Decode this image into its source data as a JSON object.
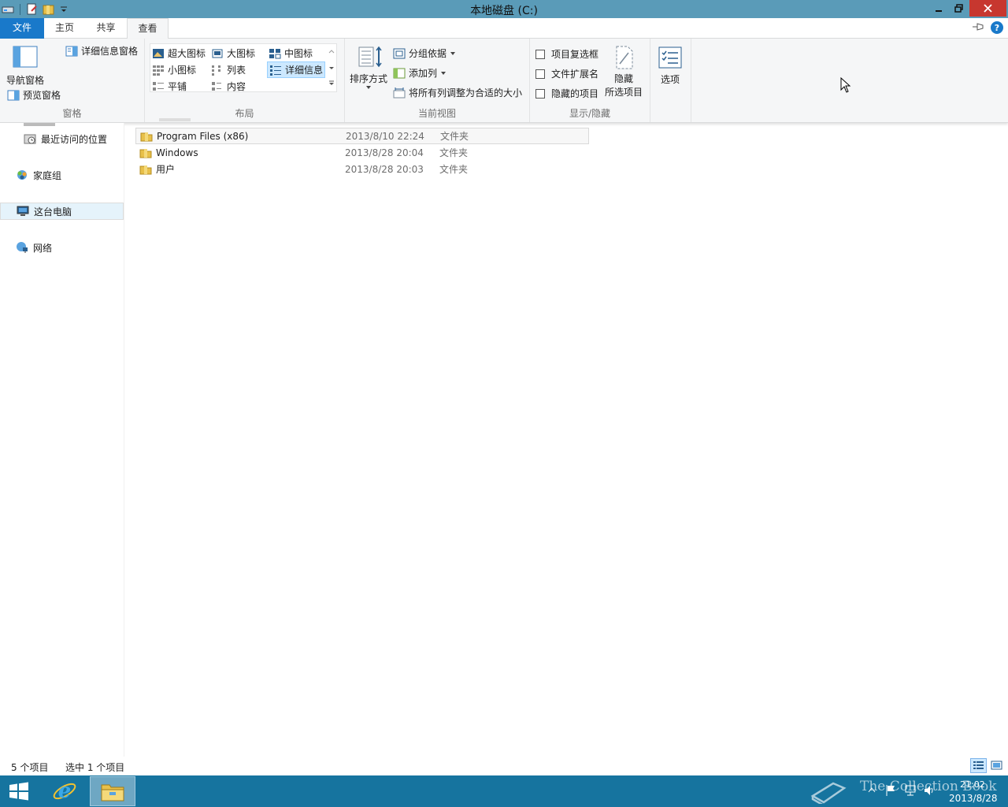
{
  "window": {
    "title": "本地磁盘 (C:)"
  },
  "ribbon": {
    "tabs": {
      "file": "文件",
      "home": "主页",
      "share": "共享",
      "view": "查看"
    },
    "panes": {
      "nav_pane": "导航窗格",
      "preview_pane": "预览窗格",
      "details_pane": "详细信息窗格",
      "label": "窗格"
    },
    "layout": {
      "extra_large": "超大图标",
      "large": "大图标",
      "medium": "中图标",
      "small": "小图标",
      "list": "列表",
      "details": "详细信息",
      "tiles": "平铺",
      "content": "内容",
      "label": "布局"
    },
    "current_view": {
      "sort_by": "排序方式",
      "group_by": "分组依据",
      "add_columns": "添加列",
      "size_all_columns": "将所有列调整为合适的大小",
      "label": "当前视图"
    },
    "show_hide": {
      "item_checkboxes": "项目复选框",
      "file_extensions": "文件扩展名",
      "hidden_items": "隐藏的项目",
      "hide_selected_1": "隐藏",
      "hide_selected_2": "所选项目",
      "label": "显示/隐藏"
    },
    "options": "选项"
  },
  "nav": {
    "recent": "最近访问的位置",
    "homegroup": "家庭组",
    "this_pc": "这台电脑",
    "network": "网络"
  },
  "files": [
    {
      "name": "Program Files (x86)",
      "date": "2013/8/10 22:24",
      "type": "文件夹"
    },
    {
      "name": "Windows",
      "date": "2013/8/28 20:04",
      "type": "文件夹"
    },
    {
      "name": "用户",
      "date": "2013/8/28 20:03",
      "type": "文件夹"
    }
  ],
  "status": {
    "item_count": "5 个项目",
    "selected": "选中 1 个项目"
  },
  "taskbar": {
    "time": "21:02",
    "date": "2013/8/28",
    "watermark": "The Collection Book"
  },
  "colors": {
    "titlebar": "#5a9bb8",
    "file_tab": "#1979ca",
    "taskbar": "#16749f",
    "close_button": "#c7372f"
  }
}
